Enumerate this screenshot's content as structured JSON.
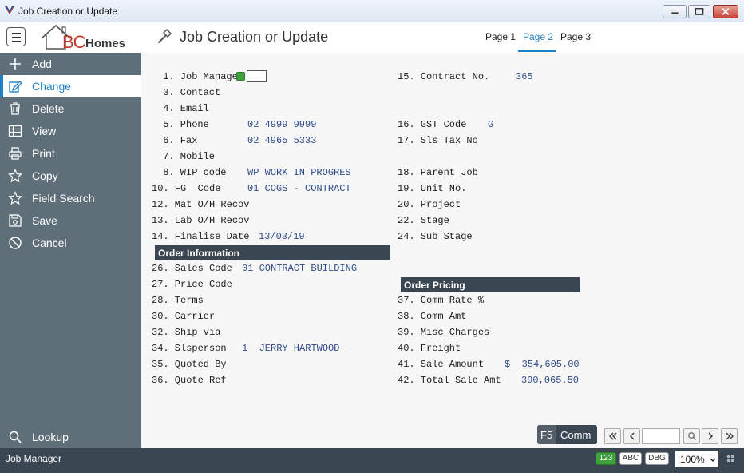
{
  "window": {
    "title": "Job Creation or Update"
  },
  "header": {
    "logo_bc": "BC",
    "logo_homes": "Homes",
    "page_title": "Job Creation or Update",
    "tabs": [
      {
        "label": "Page 1"
      },
      {
        "label": "Page 2",
        "active": true
      },
      {
        "label": "Page 3"
      }
    ]
  },
  "sidebar": {
    "items": [
      {
        "label": "Add",
        "icon": "plus-icon"
      },
      {
        "label": "Change",
        "icon": "edit-icon",
        "active": true
      },
      {
        "label": "Delete",
        "icon": "trash-icon"
      },
      {
        "label": "View",
        "icon": "table-icon"
      },
      {
        "label": "Print",
        "icon": "printer-icon"
      },
      {
        "label": "Copy",
        "icon": "star-icon"
      },
      {
        "label": "Field Search",
        "icon": "star-icon"
      },
      {
        "label": "Save",
        "icon": "save-icon"
      },
      {
        "label": "Cancel",
        "icon": "cancel-icon"
      }
    ],
    "lookup": {
      "label": "Lookup",
      "icon": "search-icon"
    }
  },
  "form": {
    "left": [
      {
        "label": " 1. Job Manager",
        "value": ""
      },
      {
        "label": " 3. Contact",
        "value": ""
      },
      {
        "label": " 4. Email",
        "value": ""
      },
      {
        "label": " 5. Phone",
        "value": "02 4999 9999"
      },
      {
        "label": " 6. Fax",
        "value": "02 4965 5333"
      },
      {
        "label": " 7. Mobile",
        "value": ""
      },
      {
        "label": " 8. WIP code",
        "value": "WP WORK IN PROGRES"
      },
      {
        "label": "10. FG  Code",
        "value": "01 COGS - CONTRACT"
      },
      {
        "label": "12. Mat O/H Recov",
        "value": ""
      },
      {
        "label": "13. Lab O/H Recov",
        "value": ""
      },
      {
        "label": "14. Finalise Date",
        "value": "13/03/19"
      }
    ],
    "order_information_title": "Order Information",
    "order_left": [
      {
        "label": "26. Sales Code",
        "value": "01 CONTRACT BUILDING"
      },
      {
        "label": "27. Price Code",
        "value": ""
      },
      {
        "label": "28. Terms",
        "value": ""
      },
      {
        "label": "30. Carrier",
        "value": ""
      },
      {
        "label": "32. Ship via",
        "value": ""
      },
      {
        "label": "34. Slsperson",
        "value": "1  JERRY HARTWOOD"
      },
      {
        "label": "35. Quoted By",
        "value": ""
      },
      {
        "label": "36. Quote Ref",
        "value": ""
      }
    ],
    "right": [
      {
        "label": "15. Contract No.",
        "value": "365"
      },
      {
        "label": "16. GST Code",
        "value": "G"
      },
      {
        "label": "17. Sls Tax No",
        "value": ""
      },
      {
        "label": "18. Parent Job",
        "value": ""
      },
      {
        "label": "19. Unit No.",
        "value": ""
      },
      {
        "label": "20. Project",
        "value": ""
      },
      {
        "label": "22. Stage",
        "value": ""
      },
      {
        "label": "24. Sub Stage",
        "value": ""
      }
    ],
    "order_pricing_title": "Order Pricing",
    "pricing": [
      {
        "label": "37. Comm Rate %",
        "value": ""
      },
      {
        "label": "38. Comm Amt",
        "value": ""
      },
      {
        "label": "39. Misc Charges",
        "value": ""
      },
      {
        "label": "40. Freight",
        "value": ""
      },
      {
        "label": "41. Sale Amount",
        "value": "$  354,605.00"
      },
      {
        "label": "42. Total Sale Amt",
        "value": "390,065.50"
      }
    ]
  },
  "footer": {
    "f5_key": "F5",
    "f5_label": "Comm"
  },
  "statusbar": {
    "text": "Job Manager",
    "badge_num": "123",
    "badge_abc": "ABC",
    "badge_dbg": "DBG",
    "zoom": "100%"
  },
  "colors": {
    "sidebar": "#5f6f7a",
    "accent": "#1f7fc4",
    "section": "#3a4651",
    "value": "#2f4b8a"
  }
}
